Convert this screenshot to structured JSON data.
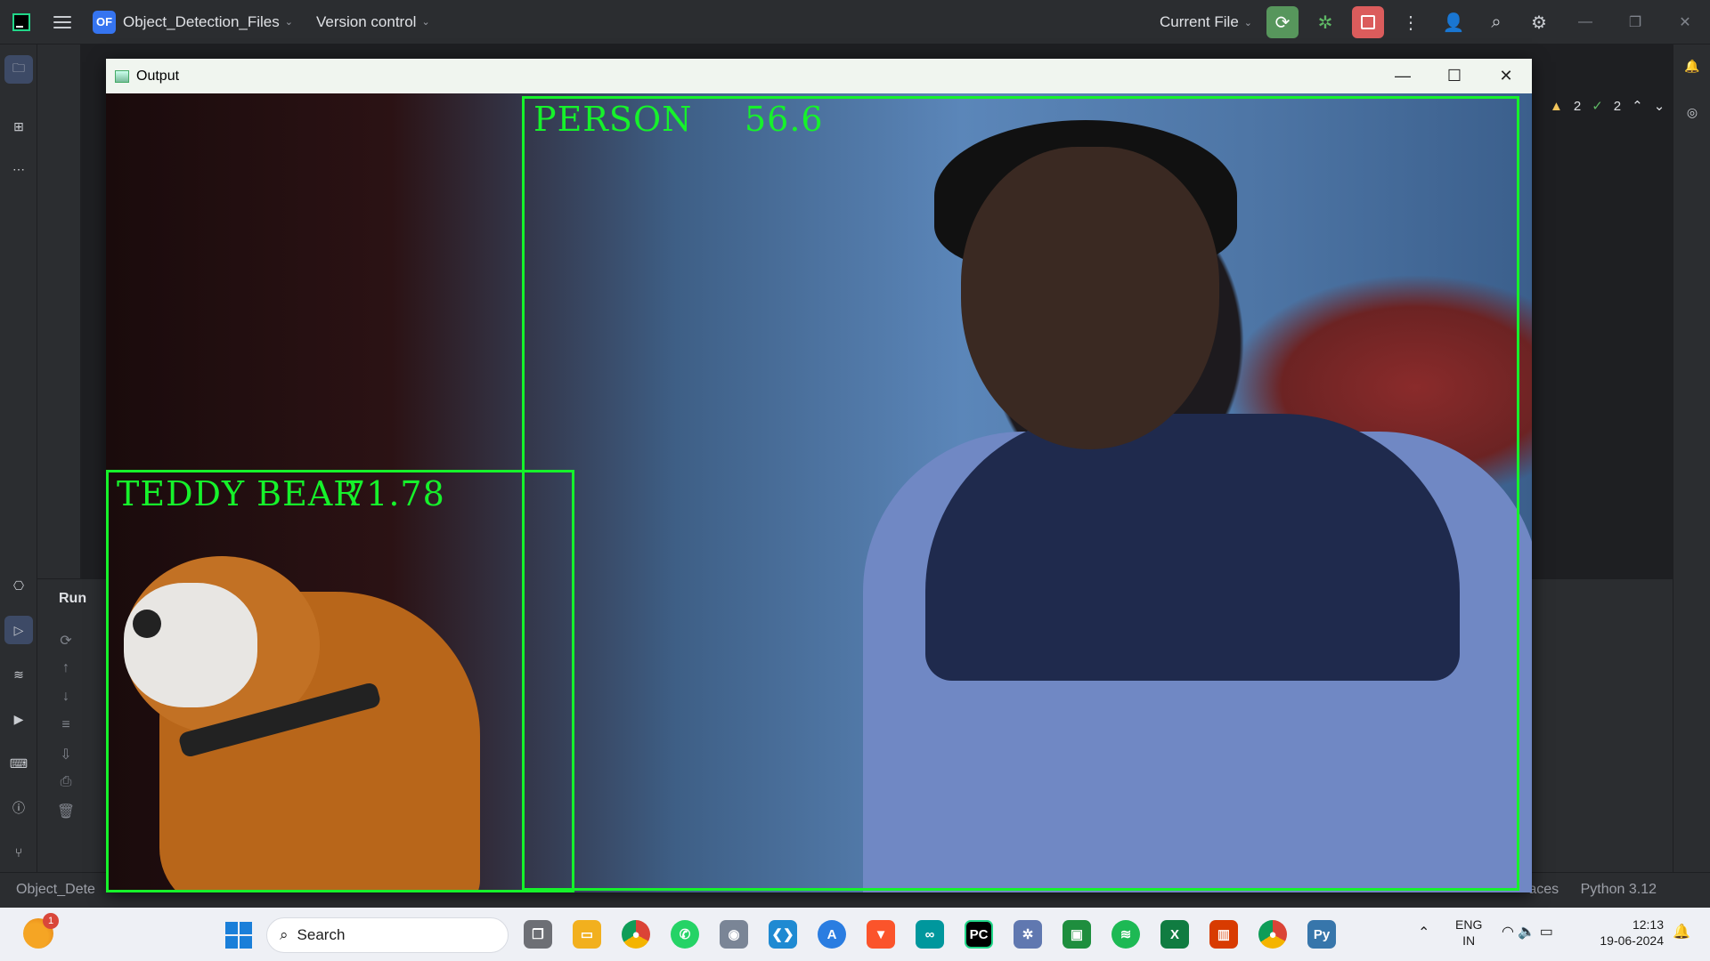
{
  "ide": {
    "project_badge": "OF",
    "project_name": "Object_Detection_Files",
    "vcs_label": "Version control",
    "run_config": "Current File",
    "run_panel_title": "Run",
    "warnings_count": "2",
    "checks_count": "2"
  },
  "status_bar": {
    "left": "Object_Dete",
    "right": "Python 3.12",
    "right_partial": "aces"
  },
  "output_window": {
    "title": "Output",
    "detections": [
      {
        "label": "PERSON",
        "score": "56.6",
        "color": "#16f22b"
      },
      {
        "label": "TEDDY BEAR",
        "score": "71.78",
        "color": "#16f22b"
      }
    ]
  },
  "taskbar": {
    "weather_badge": "1",
    "search_placeholder": "Search",
    "apps": [
      "file-explorer",
      "chrome",
      "whatsapp",
      "camera",
      "vscode",
      "app-store",
      "brave",
      "arduino",
      "pycharm",
      "bug-app",
      "classroom",
      "spotify",
      "excel",
      "office",
      "chrome-profile",
      "python"
    ],
    "language_top": "ENG",
    "language_bottom": "IN",
    "time": "12:13",
    "date": "19-06-2024"
  },
  "colors": {
    "ide_bg": "#2b2d30",
    "accent": "#3574f0",
    "detection_green": "#16f22b",
    "taskbar_bg": "#eef0f5"
  }
}
